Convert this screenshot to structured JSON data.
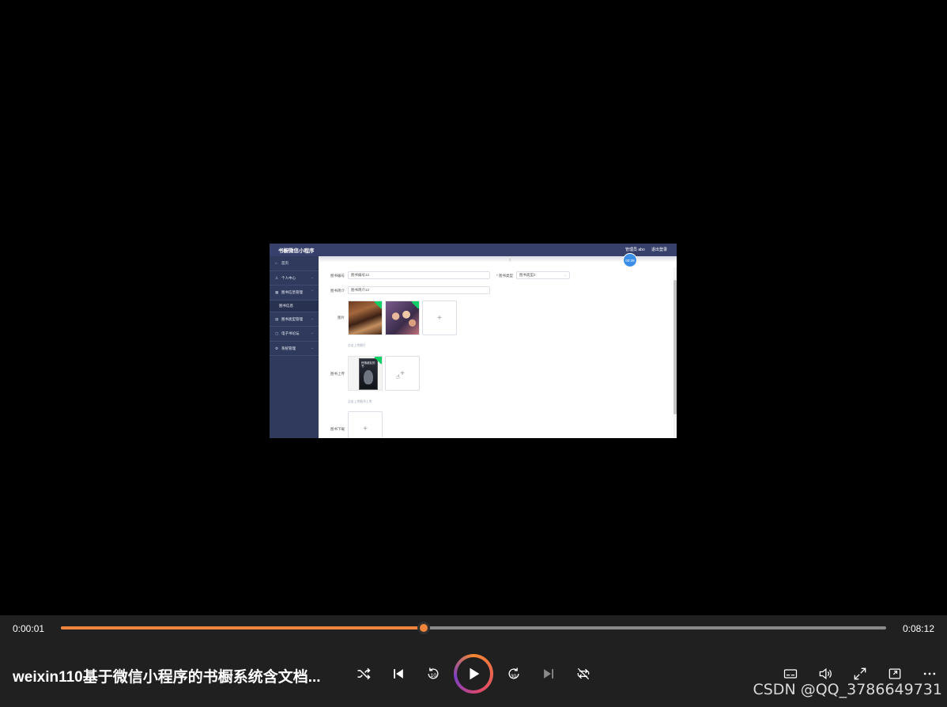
{
  "player": {
    "current_time": "0:00:01",
    "total_time": "0:08:12",
    "progress_fraction": 0.44,
    "title": "weixin110基于微信小程序的书橱系统含文档...",
    "watermark": "CSDN @QQ_3786649731",
    "accent_color": "#f0843c"
  },
  "video_app": {
    "title": "书橱微信小程序",
    "admin_label": "管理员 abo",
    "logout_label": "退出登录",
    "timer_badge": "00:39",
    "collapse_icon": "≡",
    "sidebar": {
      "home": "首页",
      "personal_center": "个人中心",
      "book_info_mgmt": "图书信息管理",
      "book_info_sub": "图书信息",
      "book_type_mgmt": "图书类型管理",
      "ebook_forum": "电子书论坛",
      "system_mgmt": "系统管理"
    },
    "form": {
      "book_no_label": "图书编号",
      "book_no_value": "图书编号12",
      "book_type_label": "* 图书类型",
      "book_type_value": "图书类型2",
      "book_intro_label": "图书简介",
      "book_intro_value": "图书简介12",
      "image_label": "图片",
      "image_hint": "点击上传图片",
      "upload_label": "图书上传",
      "upload_hint": "点击上传图书上传",
      "download_label": "图书下载",
      "book_cover_text": "怀抱朋友的书"
    }
  }
}
